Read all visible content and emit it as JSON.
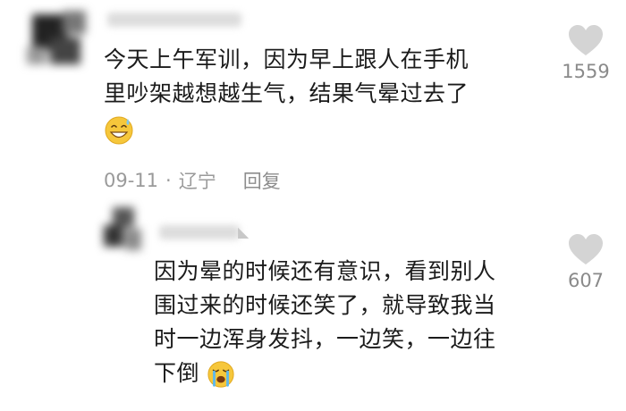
{
  "comments": [
    {
      "text_line1": "今天上午军训，因为早上跟人在手机",
      "text_line2": "里吵架越想越生气，结果气晕过去了",
      "emoji": "grinning-sweat-emoji",
      "date": "09-11",
      "separator": "·",
      "location": "辽宁",
      "reply_label": "回复",
      "likes": "1559"
    },
    {
      "text_line1": "因为晕的时候还有意识，看到别人",
      "text_line2": "围过来的时候还笑了，就导致我当",
      "text_line3": "时一边浑身发抖，一边笑，一边往",
      "text_line4": "下倒",
      "emoji": "loudly-crying-emoji",
      "likes": "607"
    }
  ],
  "colors": {
    "text": "#1b1b1b",
    "meta": "#9a9a9a",
    "heart": "#d4d4d4",
    "emoji_face": "#f6c73b"
  }
}
